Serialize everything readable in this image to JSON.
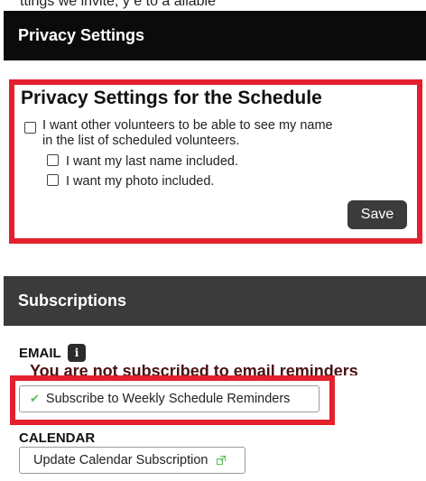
{
  "top_fragment": "ttings we invite, y e to a ailable",
  "privacy_header": {
    "title": "Privacy Settings"
  },
  "privacy_schedule": {
    "title": "Privacy Settings for the Schedule",
    "option_show_name_line1": "I want other volunteers to be able to see my name",
    "option_show_name_line2": "in the list of scheduled volunteers.",
    "option_last_name": "I want my last name included.",
    "option_photo": "I want my photo included.",
    "save_label": "Save"
  },
  "subscriptions_header": {
    "title": "Subscriptions"
  },
  "email": {
    "label": "EMAIL",
    "info_glyph": "i",
    "status_text": "You are not subscribed to email reminders",
    "subscribe_button": "Subscribe to Weekly Schedule Reminders"
  },
  "calendar": {
    "label": "CALENDAR",
    "update_button": "Update Calendar Subscription"
  },
  "colors": {
    "highlight": "#e3202c",
    "header_dark": "#0b0b0b",
    "header_gray": "#3b3b3b",
    "check_green": "#5cb85c"
  },
  "icons": [
    "info-icon",
    "check-icon",
    "external-link-icon"
  ]
}
